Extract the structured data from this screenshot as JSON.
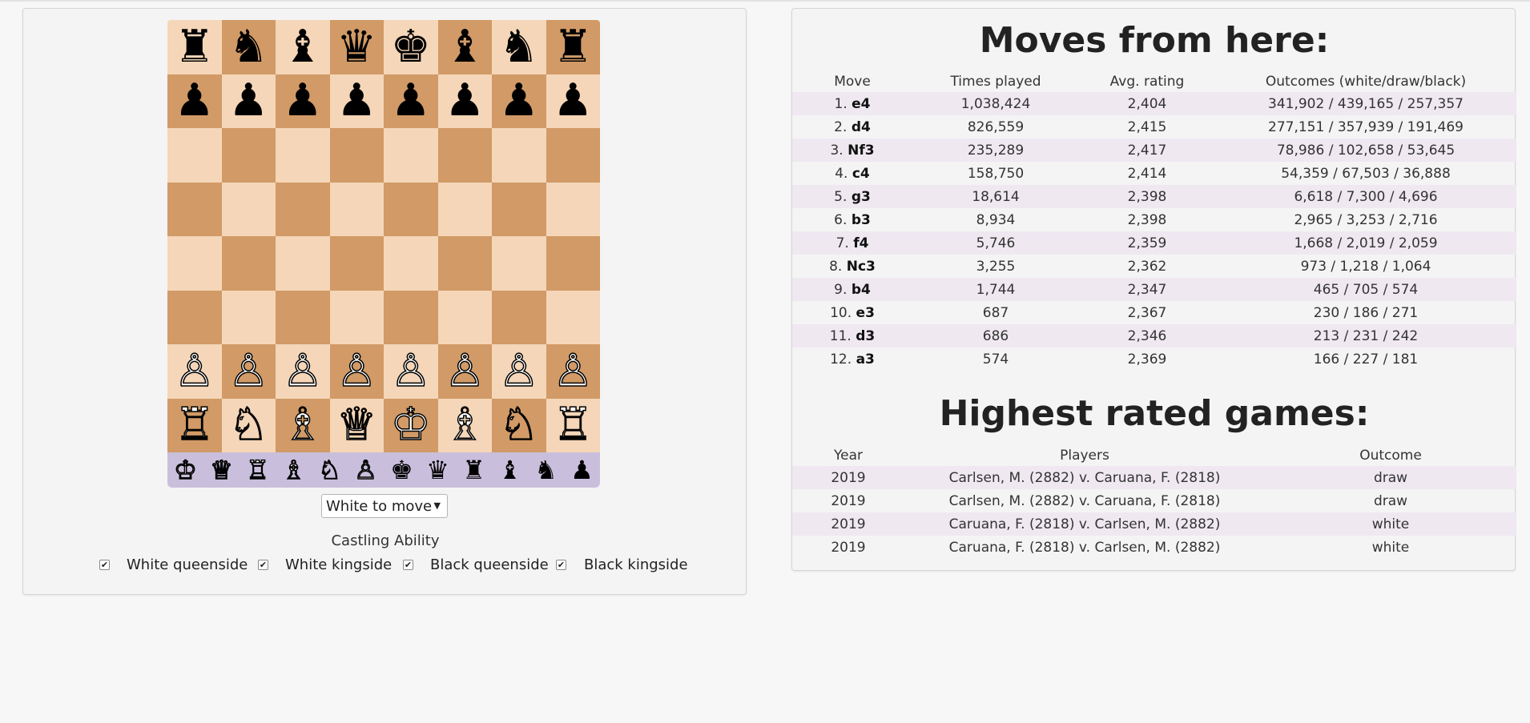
{
  "board": {
    "rows": [
      [
        "♜",
        "♞",
        "♝",
        "♛",
        "♚",
        "♝",
        "♞",
        "♜"
      ],
      [
        "♟",
        "♟",
        "♟",
        "♟",
        "♟",
        "♟",
        "♟",
        "♟"
      ],
      [
        "",
        "",
        "",
        "",
        "",
        "",
        "",
        ""
      ],
      [
        "",
        "",
        "",
        "",
        "",
        "",
        "",
        ""
      ],
      [
        "",
        "",
        "",
        "",
        "",
        "",
        "",
        ""
      ],
      [
        "",
        "",
        "",
        "",
        "",
        "",
        "",
        ""
      ],
      [
        "♙",
        "♙",
        "♙",
        "♙",
        "♙",
        "♙",
        "♙",
        "♙"
      ],
      [
        "♖",
        "♘",
        "♗",
        "♕",
        "♔",
        "♗",
        "♘",
        "♖"
      ]
    ],
    "colors": {
      "light": "#f5d6b8",
      "dark": "#d19a66",
      "palette_bg": "#c9bfdc"
    }
  },
  "palette": [
    "♔",
    "♕",
    "♖",
    "♗",
    "♘",
    "♙",
    "♚",
    "♛",
    "♜",
    "♝",
    "♞",
    "♟"
  ],
  "turn_select": {
    "value": "White to move"
  },
  "castling": {
    "title": "Castling Ability",
    "options": [
      {
        "label": "White queenside",
        "checked": true
      },
      {
        "label": "White kingside",
        "checked": true
      },
      {
        "label": "Black queenside",
        "checked": true
      },
      {
        "label": "Black kingside",
        "checked": true
      }
    ]
  },
  "moves": {
    "title": "Moves from here:",
    "headers": [
      "Move",
      "Times played",
      "Avg. rating",
      "Outcomes (white/draw/black)"
    ],
    "rows": [
      {
        "num": "1.",
        "move": "e4",
        "times": "1,038,424",
        "rating": "2,404",
        "outcomes": "341,902 / 439,165 / 257,357"
      },
      {
        "num": "2.",
        "move": "d4",
        "times": "826,559",
        "rating": "2,415",
        "outcomes": "277,151 / 357,939 / 191,469"
      },
      {
        "num": "3.",
        "move": "Nf3",
        "times": "235,289",
        "rating": "2,417",
        "outcomes": "78,986 / 102,658 / 53,645"
      },
      {
        "num": "4.",
        "move": "c4",
        "times": "158,750",
        "rating": "2,414",
        "outcomes": "54,359 / 67,503 / 36,888"
      },
      {
        "num": "5.",
        "move": "g3",
        "times": "18,614",
        "rating": "2,398",
        "outcomes": "6,618 / 7,300 / 4,696"
      },
      {
        "num": "6.",
        "move": "b3",
        "times": "8,934",
        "rating": "2,398",
        "outcomes": "2,965 / 3,253 / 2,716"
      },
      {
        "num": "7.",
        "move": "f4",
        "times": "5,746",
        "rating": "2,359",
        "outcomes": "1,668 / 2,019 / 2,059"
      },
      {
        "num": "8.",
        "move": "Nc3",
        "times": "3,255",
        "rating": "2,362",
        "outcomes": "973 / 1,218 / 1,064"
      },
      {
        "num": "9.",
        "move": "b4",
        "times": "1,744",
        "rating": "2,347",
        "outcomes": "465 / 705 / 574"
      },
      {
        "num": "10.",
        "move": "e3",
        "times": "687",
        "rating": "2,367",
        "outcomes": "230 / 186 / 271"
      },
      {
        "num": "11.",
        "move": "d3",
        "times": "686",
        "rating": "2,346",
        "outcomes": "213 / 231 / 242"
      },
      {
        "num": "12.",
        "move": "a3",
        "times": "574",
        "rating": "2,369",
        "outcomes": "166 / 227 / 181"
      }
    ]
  },
  "games": {
    "title": "Highest rated games:",
    "headers": [
      "Year",
      "Players",
      "Outcome"
    ],
    "rows": [
      {
        "year": "2019",
        "players": "Carlsen, M. (2882) v. Caruana, F. (2818)",
        "outcome": "draw"
      },
      {
        "year": "2019",
        "players": "Carlsen, M. (2882) v. Caruana, F. (2818)",
        "outcome": "draw"
      },
      {
        "year": "2019",
        "players": "Caruana, F. (2818) v. Carlsen, M. (2882)",
        "outcome": "white"
      },
      {
        "year": "2019",
        "players": "Caruana, F. (2818) v. Carlsen, M. (2882)",
        "outcome": "white"
      }
    ]
  }
}
